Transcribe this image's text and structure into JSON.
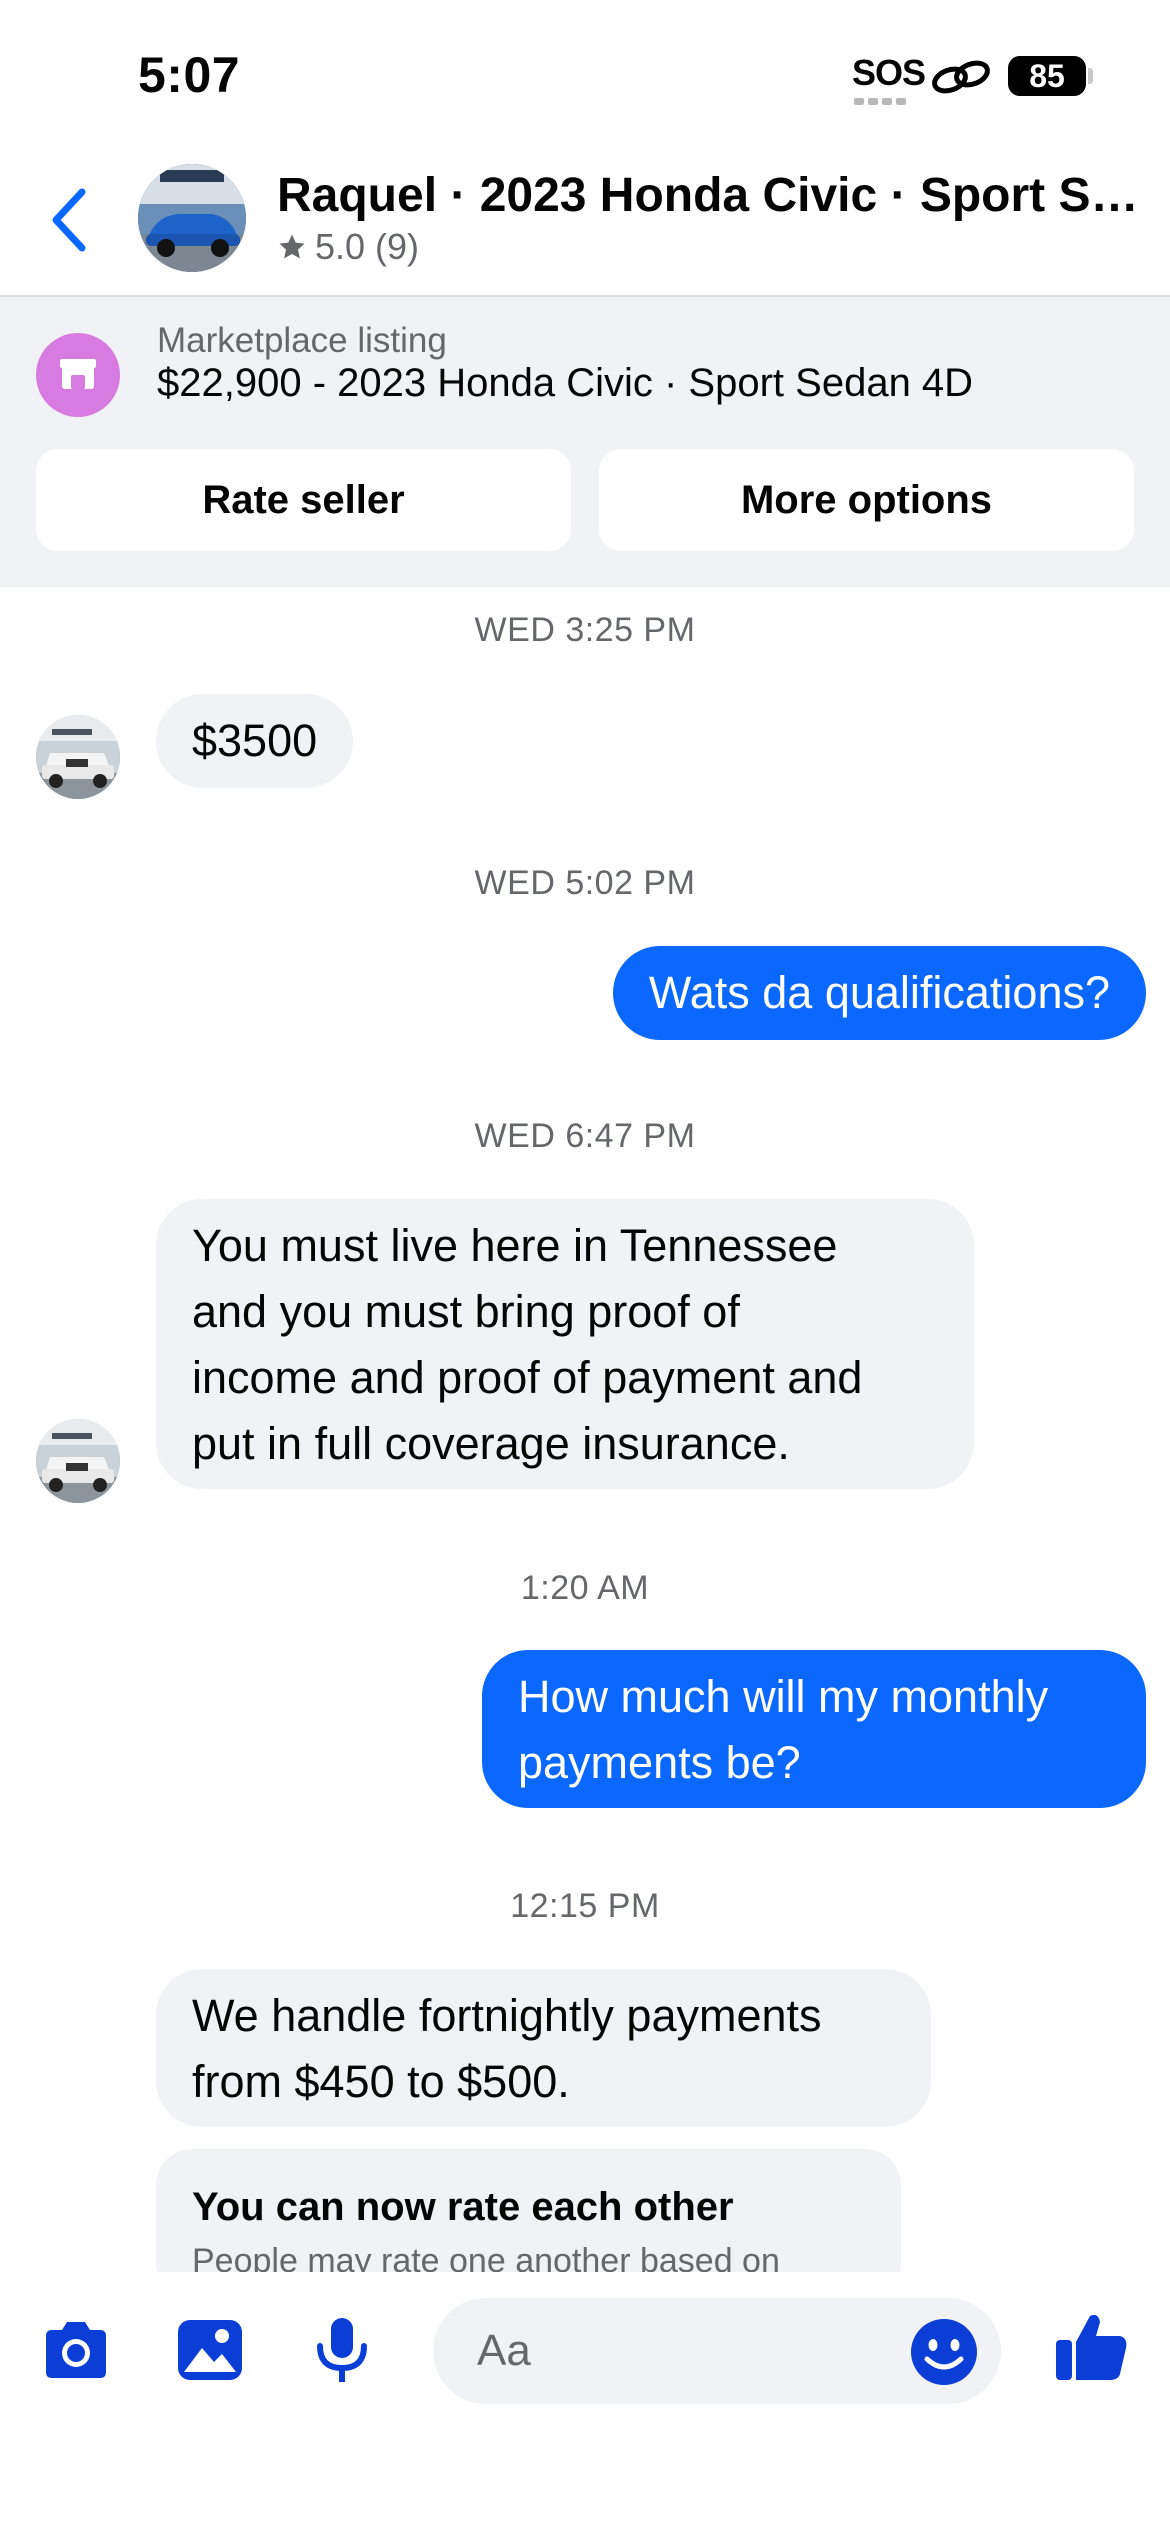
{
  "status_bar": {
    "time": "5:07",
    "sos": "SOS",
    "battery": "85"
  },
  "header": {
    "title": "Raquel · 2023 Honda Civic · Sport Sedan 4D",
    "rating": "5.0 (9)"
  },
  "listing": {
    "label": "Marketplace listing",
    "title": "$22,900 - 2023 Honda Civic · Sport Sedan 4D",
    "rate_button": "Rate seller",
    "more_button": "More options"
  },
  "messages": {
    "ts1": "WED 3:25 PM",
    "m1": "$3500",
    "ts2": "WED 5:02 PM",
    "m2": "Wats da qualifications?",
    "ts3": "WED 6:47 PM",
    "m3_l1": "You must live here in Tennessee",
    "m3_l2": "and you must bring proof of",
    "m3_l3": "income and proof of payment and",
    "m3_l4": "put in full coverage insurance.",
    "ts4": "1:20 AM",
    "m4_l1": "How much will my monthly",
    "m4_l2": "payments be?",
    "ts5": "12:15 PM",
    "m5_l1": "We handle fortnightly payments",
    "m5_l2": "from $450 to $500.",
    "card_title": "You can now rate each other",
    "card_body": "People may rate one another based on"
  },
  "composer": {
    "placeholder": "Aa"
  },
  "colors": {
    "accent": "#0a68fe",
    "icon_blue": "#0a3ed6",
    "bubble_in": "#f0f2f5",
    "store": "#d77be0"
  }
}
